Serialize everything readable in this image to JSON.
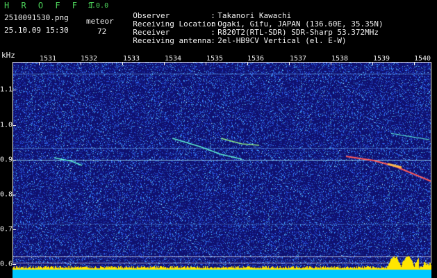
{
  "header": {
    "app_title": "H R O F F T",
    "version": "1.0.0",
    "file_name": "2510091530.png",
    "timestamp": "25.10.09 15:30",
    "meteor_label": "meteor",
    "meteor_count": "72"
  },
  "info": [
    {
      "key": "Observer",
      "sep": ":",
      "value": "Takanori Kawachi"
    },
    {
      "key": "Receiving Location",
      "sep": ":",
      "value": "Ogaki, Gifu, JAPAN (136.60E, 35.35N)"
    },
    {
      "key": "Receiver",
      "sep": ":",
      "value": "R820T2(RTL-SDR) SDR-Sharp 53.372MHz"
    },
    {
      "key": "Receiving antenna",
      "sep": ":",
      "value": "2el-HB9CV Vertical (el. E-W)"
    }
  ],
  "axes": {
    "y_unit": "kHz",
    "x_ticks": [
      "1531",
      "1532",
      "1533",
      "1534",
      "1535",
      "1536",
      "1537",
      "1538",
      "1539",
      "1540"
    ],
    "y_ticks": [
      "1.1",
      "1.0",
      "0.9",
      "0.8",
      "0.7",
      "0.6"
    ]
  },
  "colors": {
    "background": "#0f1170",
    "header_green": "#4cd35a",
    "text_white": "#f2f2f2",
    "bottom_band": "#00c8ff",
    "yellow_band": "#ffe600"
  }
}
